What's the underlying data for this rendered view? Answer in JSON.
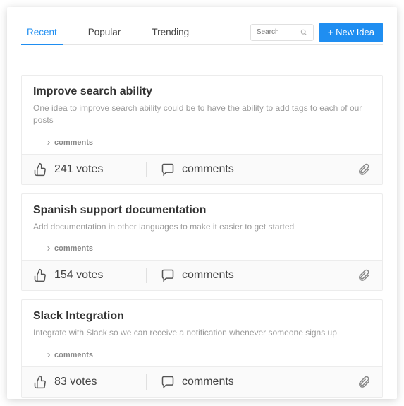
{
  "tabs": [
    {
      "label": "Recent",
      "active": true
    },
    {
      "label": "Popular",
      "active": false
    },
    {
      "label": "Trending",
      "active": false
    }
  ],
  "search": {
    "placeholder": "Search"
  },
  "newIdeaButton": "+ New Idea",
  "commentsLabel": "comments",
  "commentsToggleLabel": "comments",
  "ideas": [
    {
      "title": "Improve search ability",
      "description": "One idea to improve search ability could be to have the ability to add tags to each of our posts",
      "votes": "241 votes"
    },
    {
      "title": "Spanish support documentation",
      "description": "Add documentation in other languages to make it easier to get started",
      "votes": "154 votes"
    },
    {
      "title": "Slack Integration",
      "description": "Integrate with Slack so we can receive a notification whenever someone signs up",
      "votes": "83 votes"
    }
  ]
}
